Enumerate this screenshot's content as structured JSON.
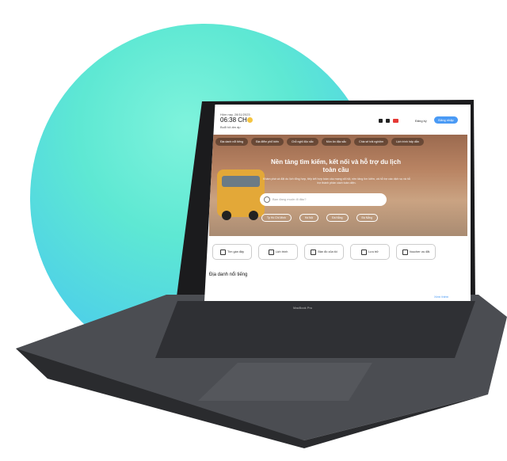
{
  "header": {
    "date": "Hôm nay, 28/11/2023",
    "time": "06:38 CH",
    "greeting": "Buổi tối ấm áp",
    "signup_label": "Đăng ký",
    "login_label": "Đăng nhập"
  },
  "hero": {
    "tabs": [
      {
        "label": "Địa danh nổi tiếng"
      },
      {
        "label": "Địa điểm phổ biến"
      },
      {
        "label": "Chỗ nghỉ độc sắc"
      },
      {
        "label": "Món ăn đặc sắc"
      },
      {
        "label": "Chia sẻ trải nghiệm"
      },
      {
        "label": "Lịch trình hấp dẫn"
      }
    ],
    "title": "Nền tảng tìm kiếm, kết nối và hỗ trợ du lịch toàn cầu",
    "subtitle": "Khám phá và đặt du lịch tổng hợp, tiếp kết hợp toàn cầu mạng xã hội, nền tảng tìm kiếm, và hỗ trợ các dịch vụ và hỗ trợ thành phần cách toàn diện.",
    "search_placeholder": "Bạn đang muốn đi đâu?",
    "chips": [
      {
        "label": "Tp Hồ Chí Minh"
      },
      {
        "label": "Hà Nội"
      },
      {
        "label": "Đà Nẵng"
      },
      {
        "label": "Đà Nẵng"
      }
    ]
  },
  "quick_actions": [
    {
      "label": "Tìm gần đây",
      "icon": "navigation-icon"
    },
    {
      "label": "Lịch trình",
      "icon": "calendar-icon"
    },
    {
      "label": "Bản đồ của tôi",
      "icon": "map-icon"
    },
    {
      "label": "Lưu trữ",
      "icon": "bookmark-icon"
    },
    {
      "label": "Voucher ưu đãi",
      "icon": "ticket-icon"
    }
  ],
  "section_title": "Địa danh nổi tiếng",
  "see_more": "Xem thêm",
  "device_brand": "MacBook Pro",
  "colors": {
    "accent": "#4a9af5",
    "circle": "#5ee8d3"
  }
}
